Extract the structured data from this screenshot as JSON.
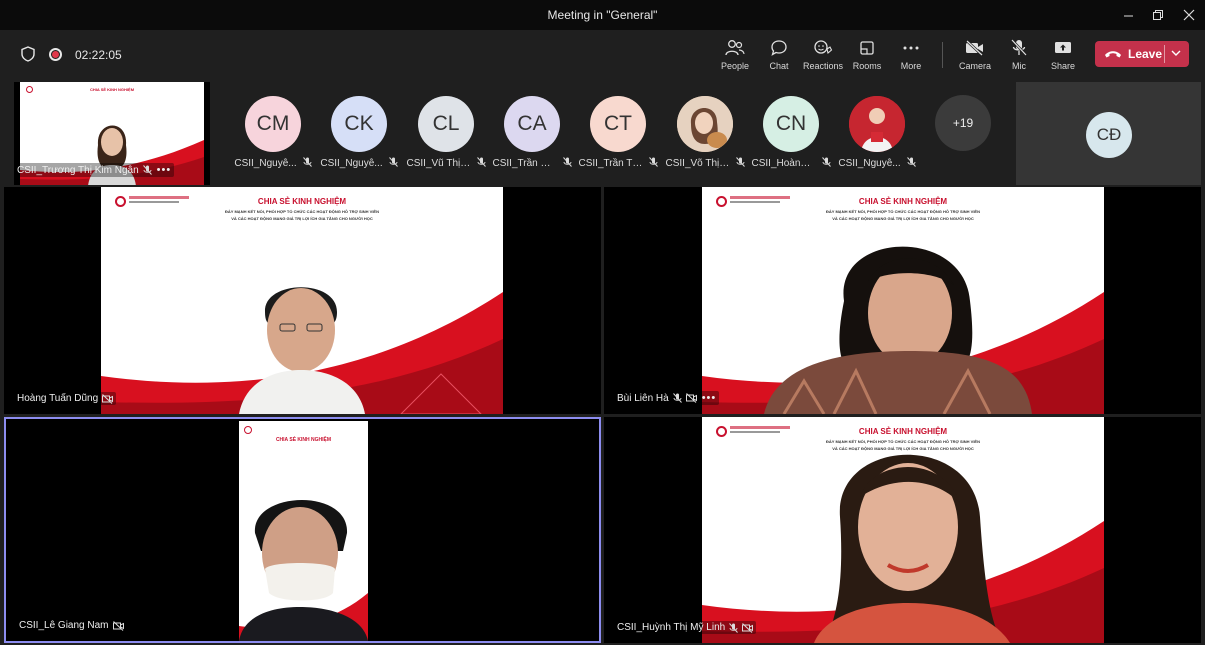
{
  "window": {
    "title": "Meeting in \"General\""
  },
  "call": {
    "elapsed": "02:22:05"
  },
  "toolbar": {
    "people": "People",
    "chat": "Chat",
    "reactions": "Reactions",
    "rooms": "Rooms",
    "more": "More",
    "camera": "Camera",
    "mic": "Mic",
    "share": "Share",
    "leave": "Leave"
  },
  "self_view": {
    "name": "CSII_Trương Thị Kim Ngân"
  },
  "participants": [
    {
      "initials": "CM",
      "name": "CSII_Nguyễ...",
      "color": "#f7d4dc"
    },
    {
      "initials": "CK",
      "name": "CSII_Nguyễ...",
      "color": "#d6dff7"
    },
    {
      "initials": "CL",
      "name": "CSII_Vũ Thị ...",
      "color": "#dfe3e8"
    },
    {
      "initials": "CA",
      "name": "CSII_Trần Đi...",
      "color": "#dcd8f0"
    },
    {
      "initials": "CT",
      "name": "CSII_Trần Th...",
      "color": "#f8d9cf"
    },
    {
      "initials": "",
      "name": "CSII_Võ Thị ...",
      "color": "#d8b9a0"
    },
    {
      "initials": "CN",
      "name": "CSII_Hoàng ...",
      "color": "#d6efe4"
    },
    {
      "initials": "",
      "name": "CSII_Nguyễ...",
      "color": "#c62630"
    }
  ],
  "overflow_count": "+19",
  "spotlight_avatar": {
    "initials": "CĐ"
  },
  "slide": {
    "title": "CHIA SẺ KINH NGHIỆM",
    "subtitle1": "ĐẨY MẠNH KẾT NỐI, PHỐI HỢP TỔ CHỨC CÁC HOẠT ĐỘNG HỖ TRỢ SINH VIÊN",
    "subtitle2": "VÀ CÁC HOẠT ĐỘNG MANG GIÁ TRỊ LỢI ÍCH GIA TĂNG CHO NGƯỜI HỌC"
  },
  "tiles": [
    {
      "name": "Hoàng Tuấn Dũng"
    },
    {
      "name": "Bùi Liên Hà"
    },
    {
      "name": "CSII_Lê Giang Nam"
    },
    {
      "name": "CSII_Huỳnh Thị Mỹ Linh"
    }
  ],
  "colors": {
    "leave": "#c4314b",
    "active_border": "#8d8df0",
    "brand_red": "#c8102e"
  }
}
